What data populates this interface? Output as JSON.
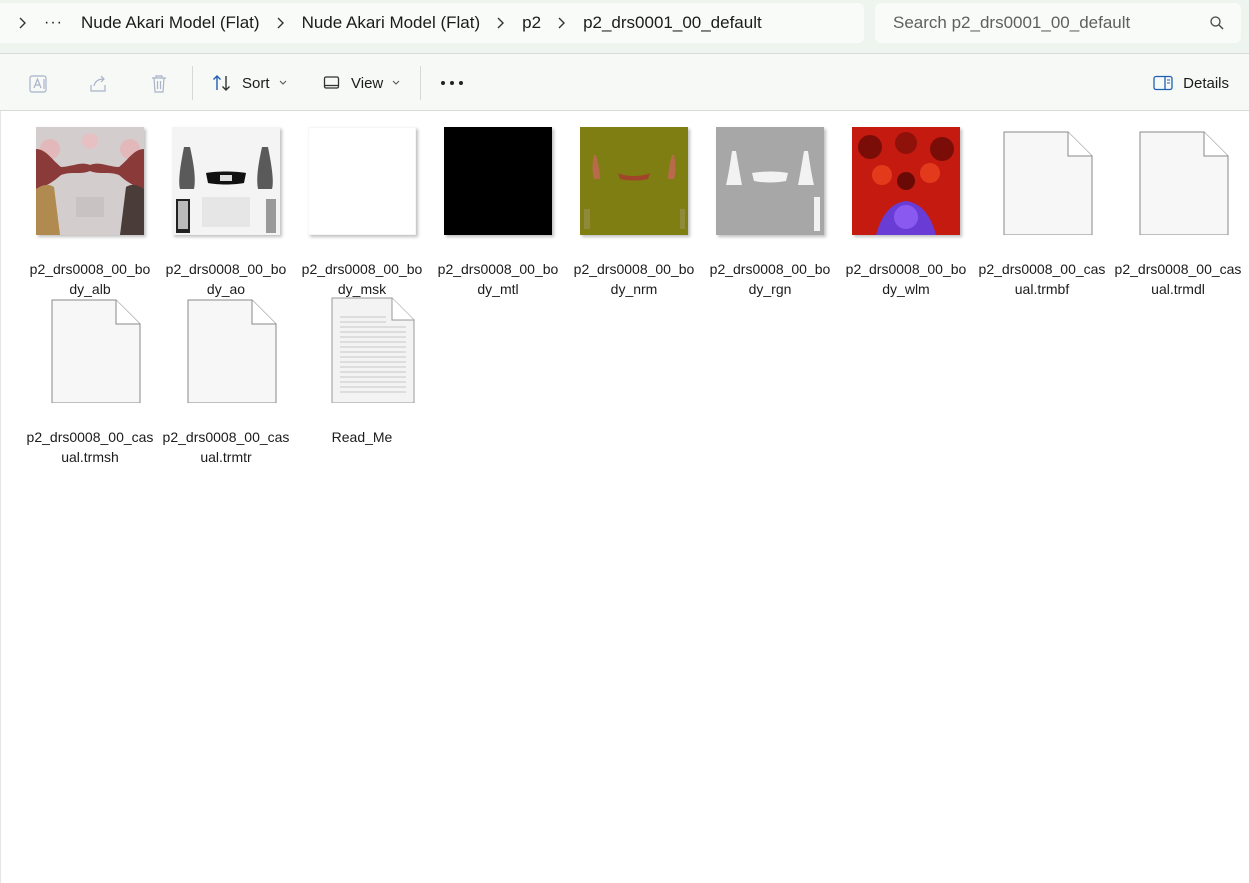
{
  "breadcrumb": {
    "items": [
      "Nude Akari Model (Flat)",
      "Nude Akari Model (Flat)",
      "p2",
      "p2_drs0001_00_default"
    ]
  },
  "search": {
    "placeholder": "Search p2_drs0001_00_default"
  },
  "toolbar": {
    "sort_label": "Sort",
    "view_label": "View",
    "details_label": "Details"
  },
  "files": [
    {
      "name": "p2_drs0008_00_body_alb",
      "kind": "image-alb"
    },
    {
      "name": "p2_drs0008_00_body_ao",
      "kind": "image-ao"
    },
    {
      "name": "p2_drs0008_00_body_msk",
      "kind": "image-msk"
    },
    {
      "name": "p2_drs0008_00_body_mtl",
      "kind": "image-mtl"
    },
    {
      "name": "p2_drs0008_00_body_nrm",
      "kind": "image-nrm"
    },
    {
      "name": "p2_drs0008_00_body_rgn",
      "kind": "image-rgn"
    },
    {
      "name": "p2_drs0008_00_body_wlm",
      "kind": "image-wlm"
    },
    {
      "name": "p2_drs0008_00_casual.trmbf",
      "kind": "blank-file"
    },
    {
      "name": "p2_drs0008_00_casual.trmdl",
      "kind": "blank-file"
    },
    {
      "name": "p2_drs0008_00_casual.trmsh",
      "kind": "blank-file"
    },
    {
      "name": "p2_drs0008_00_casual.trmtr",
      "kind": "blank-file"
    },
    {
      "name": "Read_Me",
      "kind": "text-file"
    }
  ]
}
